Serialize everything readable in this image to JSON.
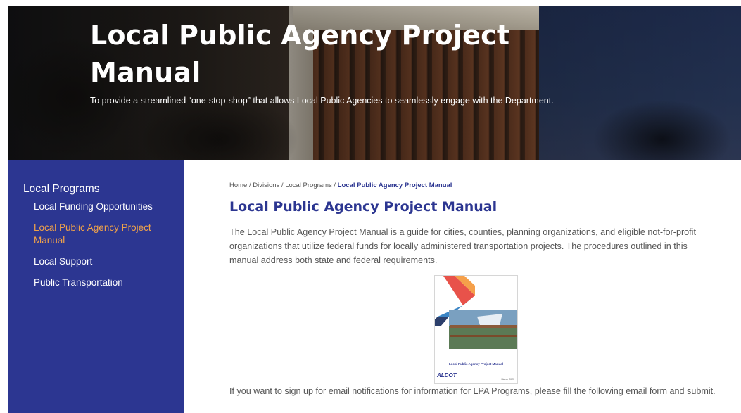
{
  "hero": {
    "title": "Local Public Agency Project Manual",
    "tagline": "To provide a streamlined “one-stop-shop” that allows Local Public Agencies to seamlessly engage with the Department."
  },
  "sidebar": {
    "title": "Local Programs",
    "items": [
      {
        "label": "Local Funding Opportunities",
        "active": false
      },
      {
        "label": "Local Public Agency Project Manual",
        "active": true
      },
      {
        "label": "Local Support",
        "active": false
      },
      {
        "label": "Public Transportation",
        "active": false
      }
    ]
  },
  "breadcrumb": {
    "items": [
      "Home",
      "Divisions",
      "Local Programs"
    ],
    "separator": " / ",
    "current": "Local Public Agency Project Manual"
  },
  "main": {
    "heading": "Local Public Agency Project Manual",
    "intro": "The Local Public Agency Project Manual is a guide for cities, counties, planning organizations, and eligible not-for-profit organizations that utilize federal funds for locally administered transportation projects. The procedures outlined in this manual address both state and federal requirements.",
    "signup": "If you want to sign up for email notifications for information for LPA Programs, please fill the following email form and submit."
  },
  "cover": {
    "title": "Local Public Agency Project Manual",
    "logo_prefix": "AL",
    "logo_main": "DOT",
    "date": "March 2021"
  },
  "colors": {
    "brand_navy": "#2c3691",
    "active_orange": "#f0a24a",
    "body_text": "#555555"
  }
}
